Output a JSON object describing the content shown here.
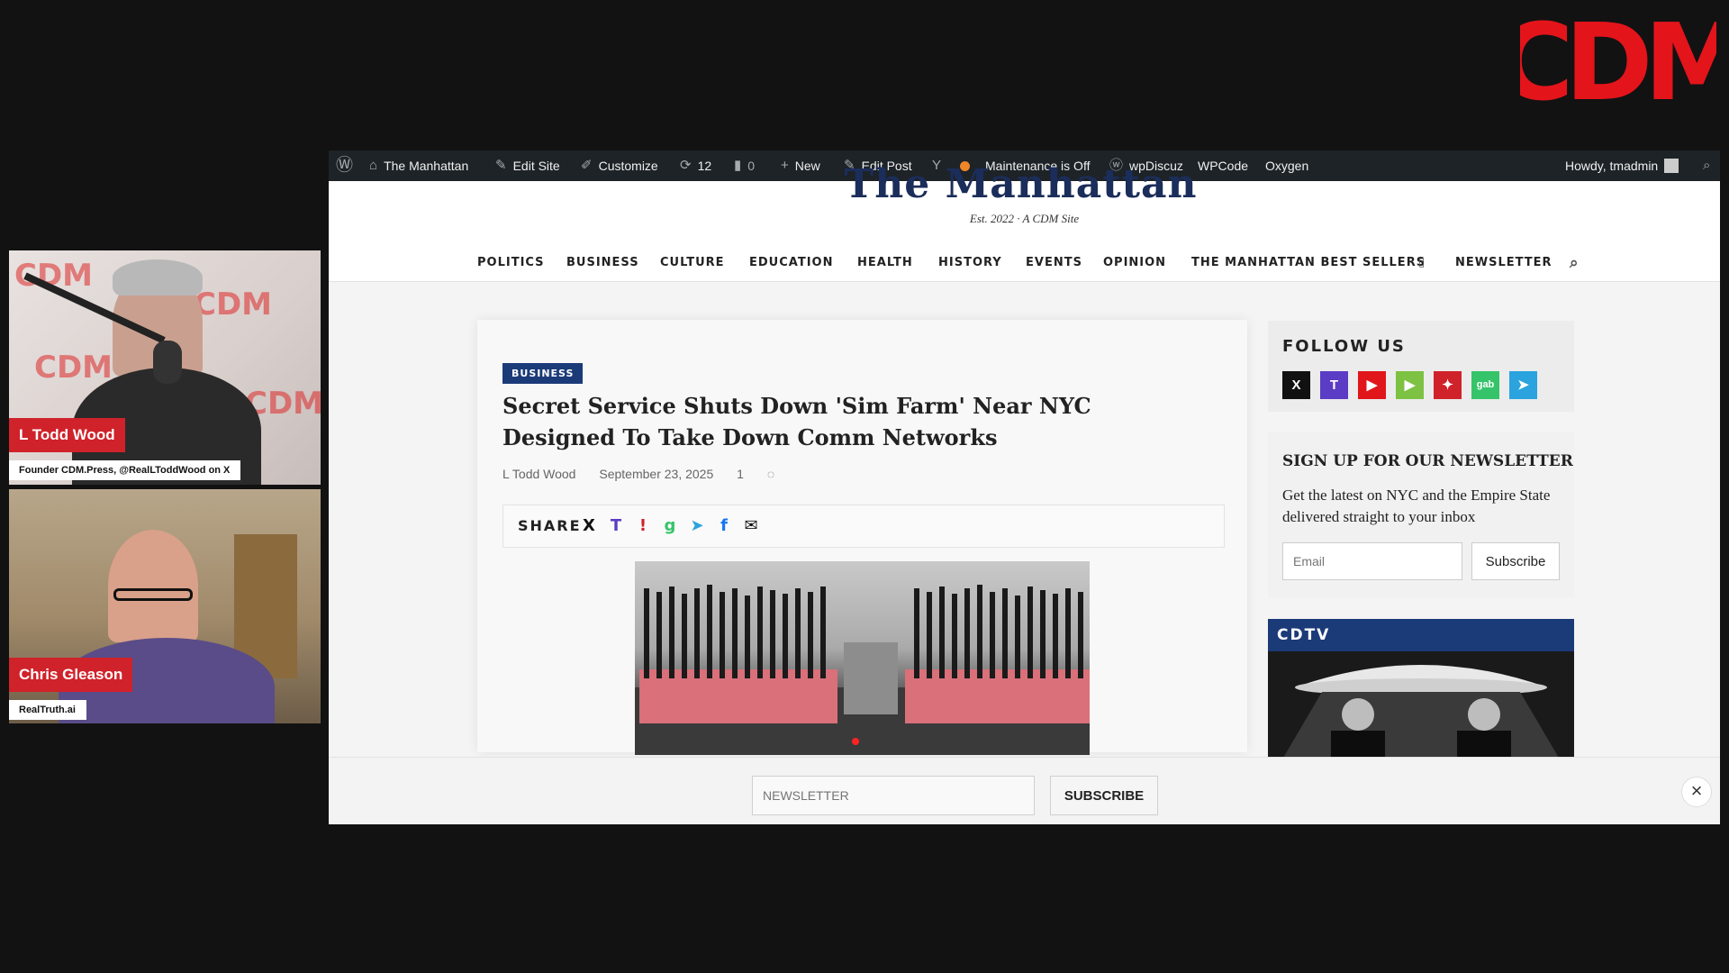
{
  "logo": {
    "text": "CDM",
    "color": "#e4141b"
  },
  "videos": [
    {
      "name": "L Todd Wood",
      "subtitle": "Founder CDM.Press, @RealLToddWood on X",
      "watermark": "CDM"
    },
    {
      "name": "Chris Gleason",
      "subtitle": "RealTruth.ai"
    }
  ],
  "admin_bar": {
    "site_name": "The Manhattan",
    "edit_site": "Edit Site",
    "customize": "Customize",
    "updates_count": "12",
    "comments_count": "0",
    "new_label": "New",
    "edit_post": "Edit Post",
    "maintenance": "Maintenance is Off",
    "wpdiscuz": "wpDiscuz",
    "wpcode": "WPCode",
    "oxygen": "Oxygen",
    "howdy": "Howdy, tmadmin"
  },
  "header": {
    "masthead": "The Manhattan",
    "tagline": "Est. 2022 · A CDM Site"
  },
  "nav": {
    "items": [
      "POLITICS",
      "BUSINESS",
      "CULTURE",
      "EDUCATION",
      "HEALTH",
      "HISTORY",
      "EVENTS",
      "OPINION",
      "THE MANHATTAN BEST SELLERS",
      "NEWSLETTER"
    ]
  },
  "article": {
    "category": "BUSINESS",
    "title": "Secret Service Shuts Down 'Sim Farm' Near NYC Designed To Take Down Comm Networks",
    "author": "L Todd Wood",
    "date": "September 23, 2025",
    "comment_count": "1",
    "share_label": "SHARE"
  },
  "sidebar": {
    "follow_title": "FOLLOW US",
    "social_letters": [
      "X",
      "T",
      "▶",
      "▶",
      "✦",
      "gab",
      "➤"
    ],
    "newsletter_title": "SIGN UP FOR OUR NEWSLETTER",
    "newsletter_desc": "Get the latest on NYC and the Empire State delivered straight to your inbox",
    "email_placeholder": "Email",
    "subscribe_label": "Subscribe",
    "cdtv_title": "CDTV"
  },
  "bottom_bar": {
    "input_placeholder": "NEWSLETTER",
    "subscribe_label": "SUBSCRIBE",
    "close_symbol": "×"
  }
}
